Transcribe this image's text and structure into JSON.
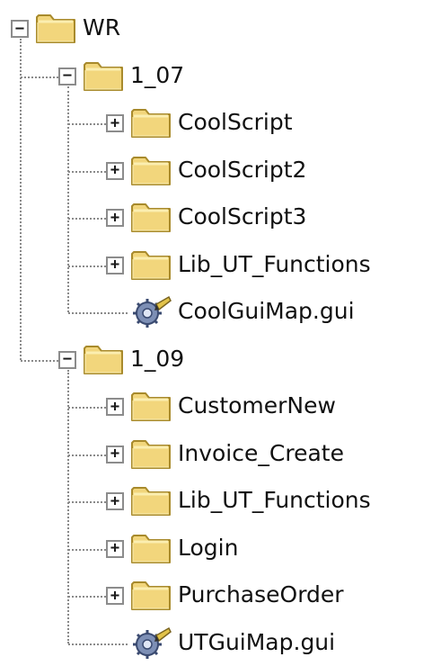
{
  "tree": {
    "root": {
      "label": "WR",
      "expanded": true,
      "toggle": "−",
      "icon": "folder-icon",
      "children": [
        {
          "label": "1_07",
          "expanded": true,
          "toggle": "−",
          "icon": "folder-icon",
          "children": [
            {
              "label": "CoolScript",
              "toggle": "+",
              "icon": "folder-icon"
            },
            {
              "label": "CoolScript2",
              "toggle": "+",
              "icon": "folder-icon"
            },
            {
              "label": "CoolScript3",
              "toggle": "+",
              "icon": "folder-icon"
            },
            {
              "label": "Lib_UT_Functions",
              "toggle": "+",
              "icon": "folder-icon"
            },
            {
              "label": "CoolGuiMap.gui",
              "icon": "gui-map-file-icon"
            }
          ]
        },
        {
          "label": "1_09",
          "expanded": true,
          "toggle": "−",
          "icon": "folder-icon",
          "children": [
            {
              "label": "CustomerNew",
              "toggle": "+",
              "icon": "folder-icon"
            },
            {
              "label": "Invoice_Create",
              "toggle": "+",
              "icon": "folder-icon"
            },
            {
              "label": "Lib_UT_Functions",
              "toggle": "+",
              "icon": "folder-icon"
            },
            {
              "label": "Login",
              "toggle": "+",
              "icon": "folder-icon"
            },
            {
              "label": "PurchaseOrder",
              "toggle": "+",
              "icon": "folder-icon"
            },
            {
              "label": "UTGuiMap.gui",
              "icon": "gui-map-file-icon"
            }
          ]
        }
      ]
    }
  },
  "colors": {
    "folder_fill": "#f2d67c",
    "folder_light": "#fbeeb0",
    "folder_outline": "#a88a2c",
    "tree_lines": "#8a8a8a"
  }
}
